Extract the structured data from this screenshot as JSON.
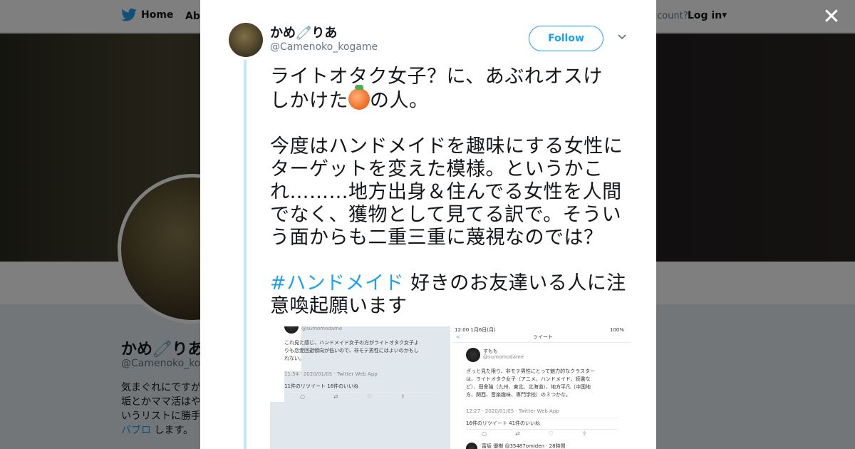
{
  "background_page": {
    "nav": {
      "home": "Home",
      "about": "Abo",
      "account_prompt": "ccount?",
      "login": "Log in"
    },
    "profile": {
      "name": "かめ🧷りあ",
      "handle": "@Camenoko_kog",
      "bio_lines": [
        "気まぐれにですが",
        "垢とかママ活はや",
        "いうリストに勝手"
      ],
      "bio_link": "パブロ",
      "bio_tail": " します。"
    }
  },
  "modal": {
    "author": {
      "name": "かめ🧷りあ",
      "handle": "@Camenoko_kogame"
    },
    "follow_label": "Follow",
    "tweet": {
      "line1a": "ライトオタク女子？に、あぶれオスけ",
      "line1b": "しかけた",
      "line1c": "の人。",
      "para2": "今度はハンドメイドを趣味にする女性にターゲットを変えた模様。というかこれ………地方出身＆住んでる女性を人間でなく、獲物として見てる訳で。そういう面からも二重三重に蔑視なのでは？",
      "hashtag": "#ハンドメイド",
      "para3": " 好きのお友達いる人に注意喚起願います"
    },
    "attachment_left": {
      "handle": "@sumomodame",
      "body1": "これ見た感じ、ハンドメイド女子の方がライトオタク女子よ",
      "body2": "りも恋愛回避傾向が低いので、非モテ男性にはよいのかもし",
      "body3": "れない。",
      "time": "11:54 · 2020/01/05 · Twitter Web App",
      "stats": "11件のリツイート  16件のいいね"
    },
    "attachment_right": {
      "status_time": "12:00  1月6日(月)",
      "battery": "100%",
      "header": "ツイート",
      "name": "すもも",
      "handle": "@sumomodame",
      "body1": "ざっと見た限り、非モテ男性にとって魅力的なクラスター",
      "body2": "は、ライトオタク女子（アニメ、ハンドメイド、読書な",
      "body3": "ど）、田舎強（九州、東北、北海道）、地方平凡（中国地",
      "body4": "方、関西、音楽趣味、専門学校）の３つかな。",
      "time": "12:27 · 2020/01/05 · Twitter Web App",
      "stats": "16件のリツイート  41件のいいね",
      "reply_user": "富坂 優樹 @35487omiden · 28時間"
    }
  },
  "colors": {
    "accent": "#1da1f2",
    "thread": "#c4e7fb"
  }
}
